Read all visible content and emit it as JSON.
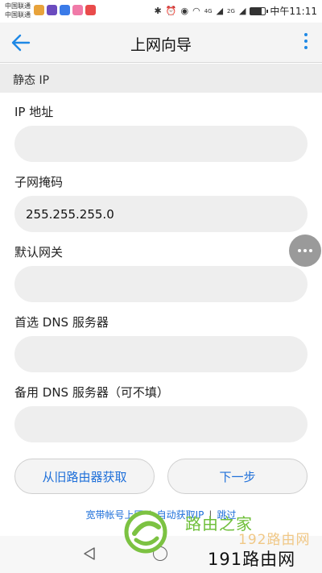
{
  "status_bar": {
    "carrier_line1": "中国联通",
    "carrier_line2": "中国联通",
    "signal_4g": "4G",
    "signal_2g": "2G",
    "battery_level": 0.75,
    "time": "中午11:11",
    "icons": [
      "weibo-icon",
      "video-icon",
      "baidu-icon",
      "gallery-icon",
      "app-icon",
      "bluetooth-icon",
      "alarm-icon",
      "eye-icon",
      "wifi-icon",
      "signal-icon",
      "battery-icon"
    ]
  },
  "header": {
    "title": "上网向导",
    "accent_color": "#1e88e5"
  },
  "section": {
    "label": "静态 IP"
  },
  "form": {
    "ip_label": "IP 地址",
    "ip_value": "",
    "subnet_label": "子网掩码",
    "subnet_value": "255.255.255.0",
    "gateway_label": "默认网关",
    "gateway_value": "",
    "dns1_label": "首选 DNS 服务器",
    "dns1_value": "",
    "dns2_label": "备用 DNS 服务器（可不填）",
    "dns2_value": ""
  },
  "buttons": {
    "restore_label": "从旧路由器获取",
    "next_label": "下一步"
  },
  "links": {
    "broadband": "宽带帐号上网",
    "auto_ip": "自动获取IP",
    "skip": "跳过",
    "separator": "|"
  },
  "watermark": {
    "line1": "路由之家",
    "line2": "192路由网",
    "line3": "191路由网"
  }
}
